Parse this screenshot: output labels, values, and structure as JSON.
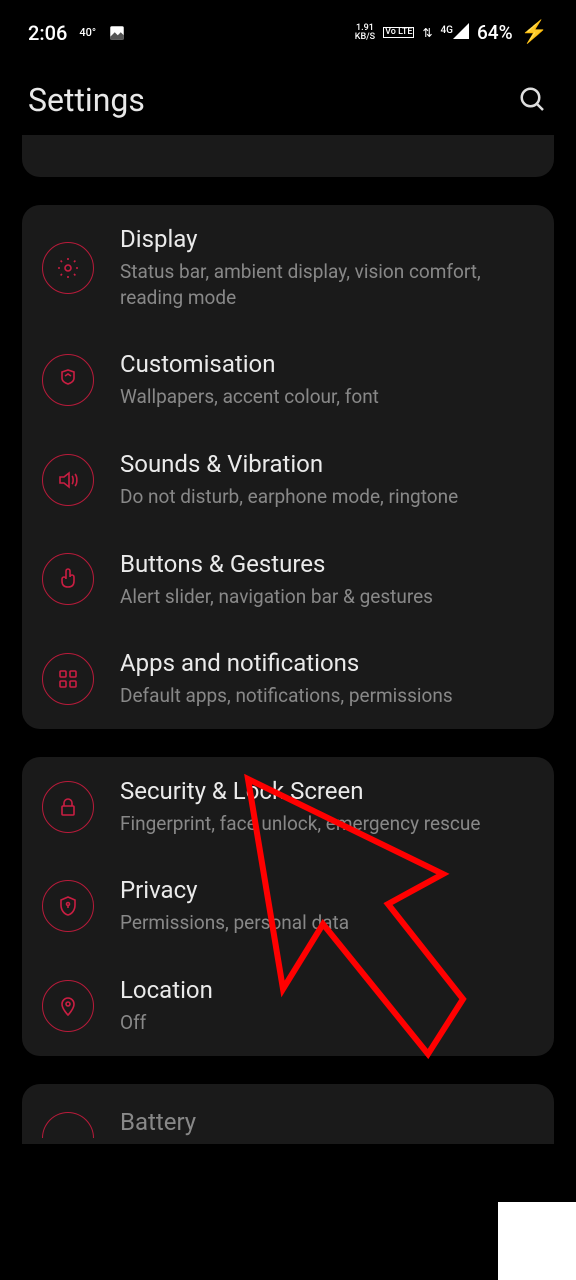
{
  "status": {
    "time": "2:06",
    "temp": "40°",
    "netspeed_top": "1.91",
    "netspeed_bottom": "KB/S",
    "volte": "Vo LTE",
    "netgen": "4G",
    "battery": "64%"
  },
  "header": {
    "title": "Settings"
  },
  "groups": [
    {
      "items": [
        {
          "icon": "display",
          "title": "Display",
          "subtitle": "Status bar, ambient display, vision comfort, reading mode"
        },
        {
          "icon": "customisation",
          "title": "Customisation",
          "subtitle": "Wallpapers, accent colour, font"
        },
        {
          "icon": "sounds",
          "title": "Sounds & Vibration",
          "subtitle": "Do not disturb, earphone mode, ringtone"
        },
        {
          "icon": "gestures",
          "title": "Buttons & Gestures",
          "subtitle": "Alert slider, navigation bar & gestures"
        },
        {
          "icon": "apps",
          "title": "Apps and notifications",
          "subtitle": "Default apps, notifications, permissions"
        }
      ]
    },
    {
      "items": [
        {
          "icon": "lock",
          "title": "Security & Lock Screen",
          "subtitle": "Fingerprint, face unlock, emergency rescue"
        },
        {
          "icon": "privacy",
          "title": "Privacy",
          "subtitle": "Permissions, personal data"
        },
        {
          "icon": "location",
          "title": "Location",
          "subtitle": "Off"
        }
      ]
    }
  ],
  "partial_bottom": {
    "title": "Battery"
  }
}
